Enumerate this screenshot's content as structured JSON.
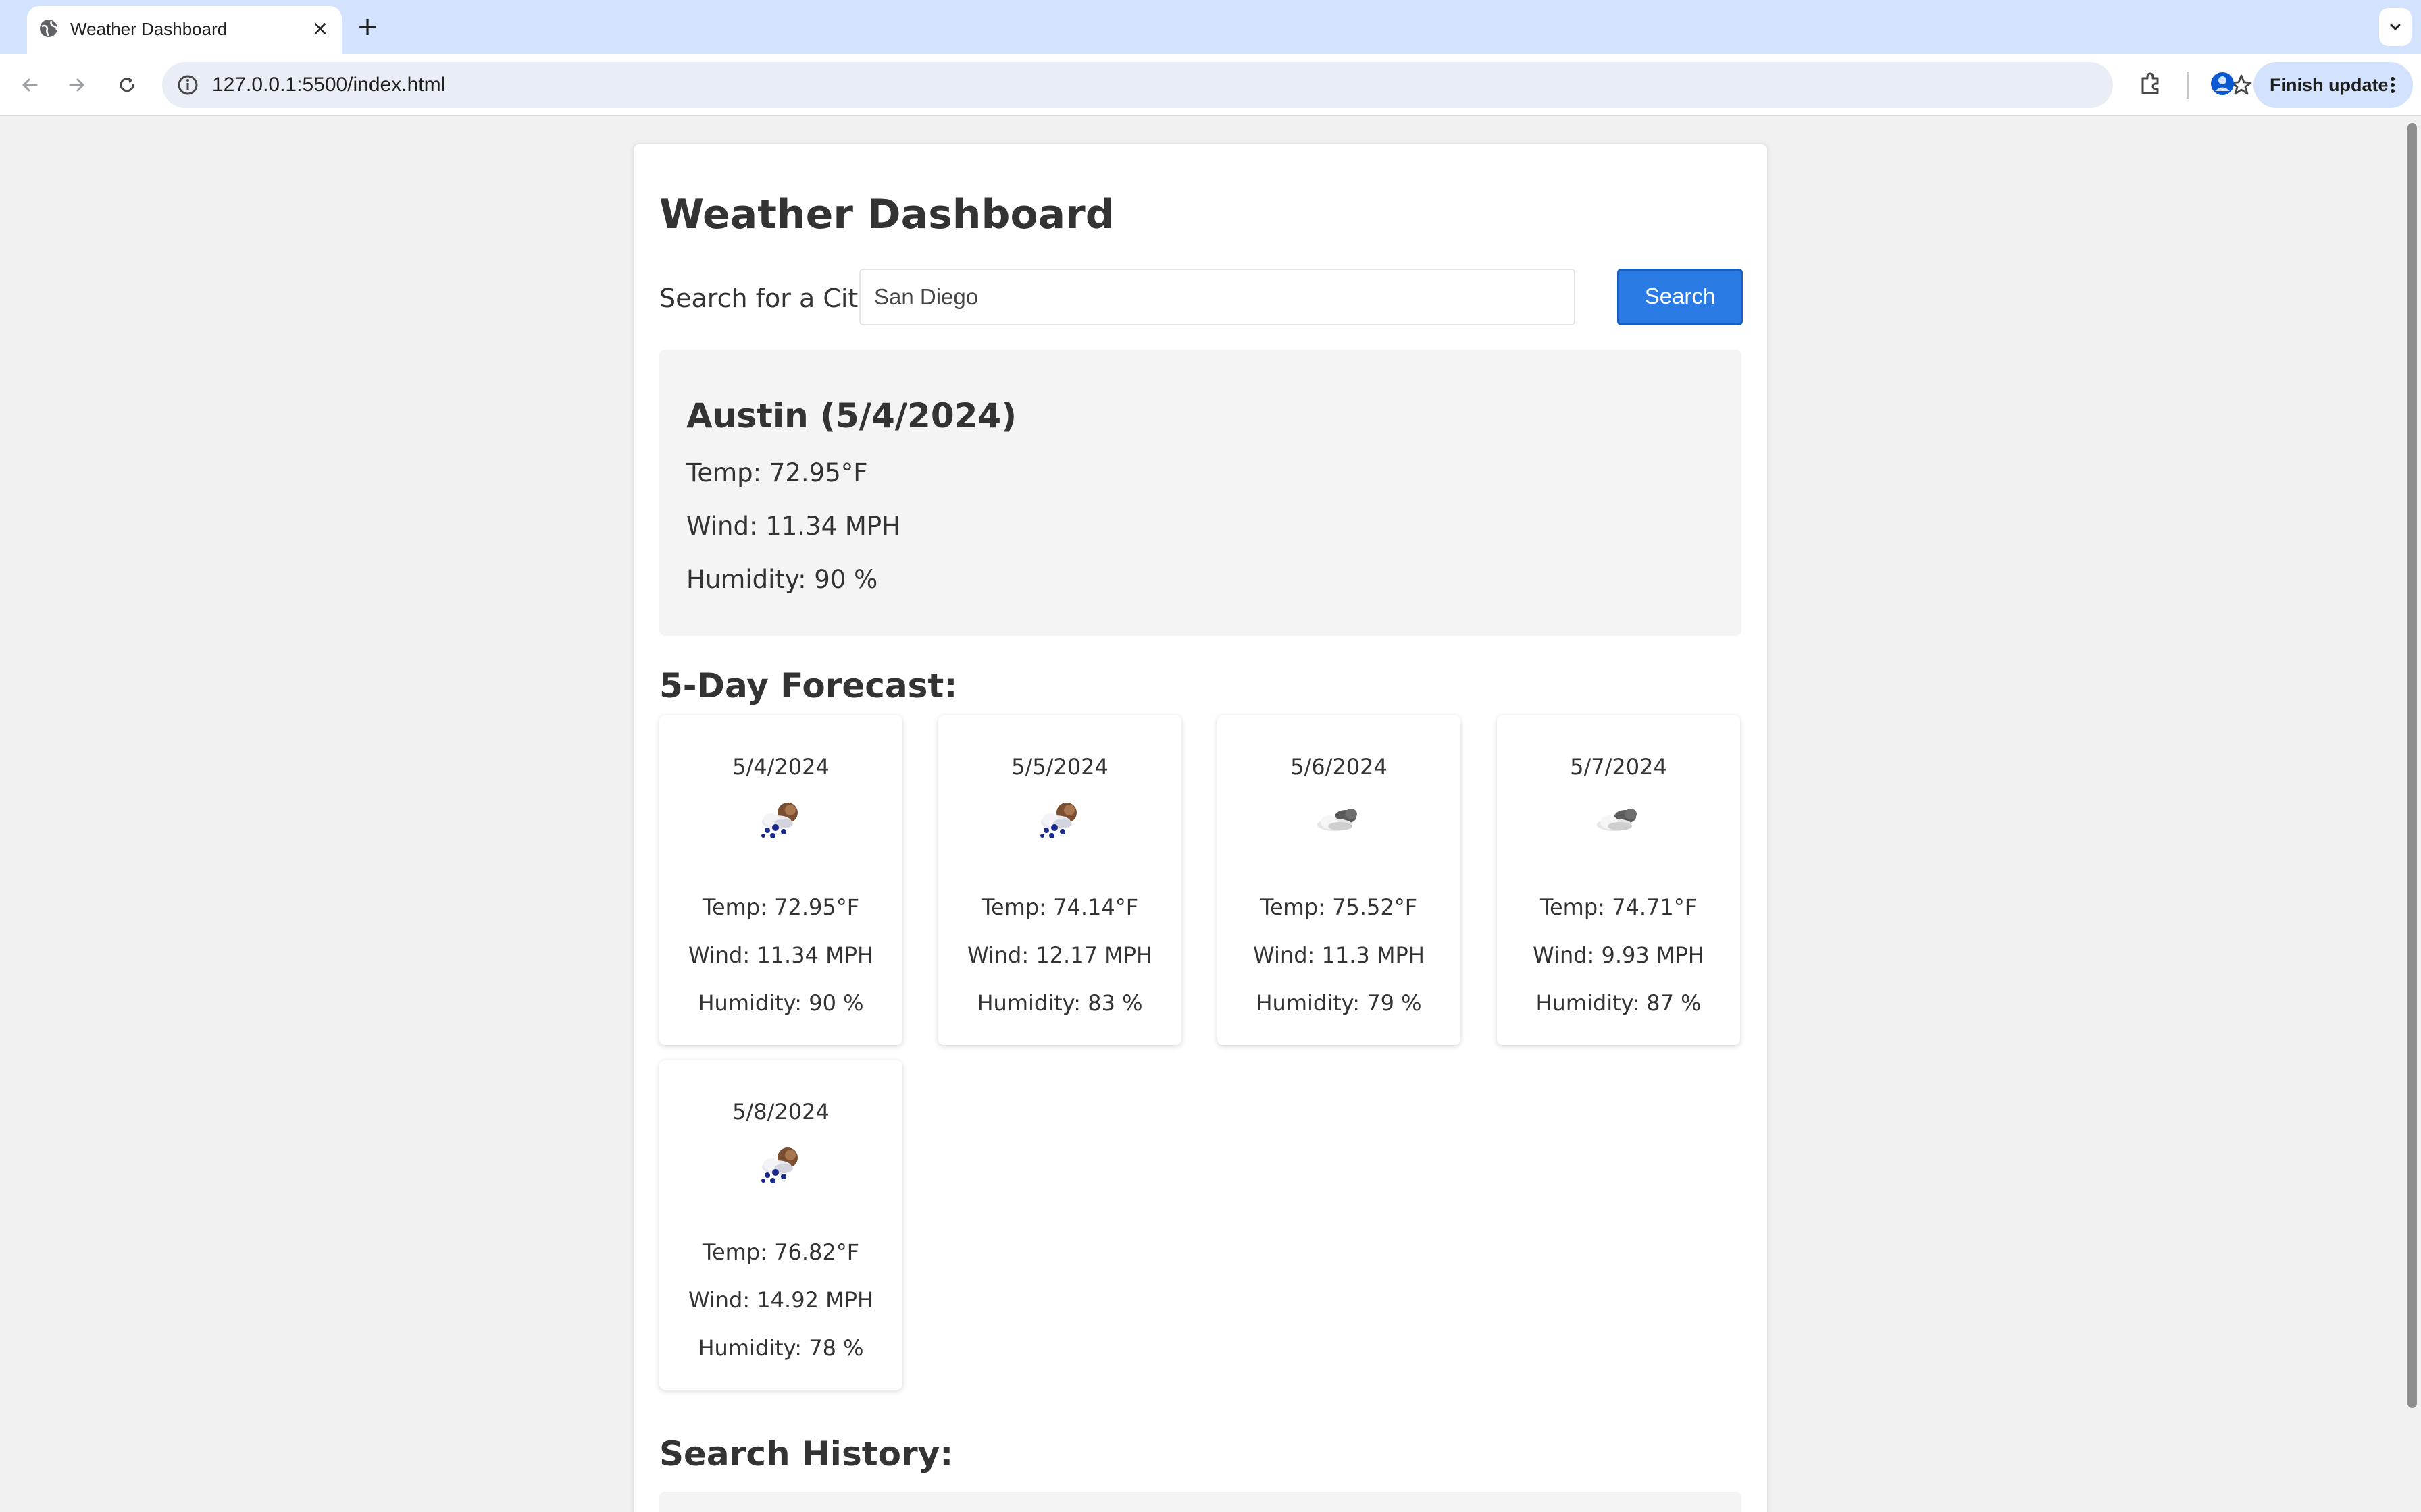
{
  "browser": {
    "tab_title": "Weather Dashboard",
    "url": "127.0.0.1:5500/index.html",
    "finish_update_label": "Finish update"
  },
  "page": {
    "title": "Weather Dashboard",
    "search": {
      "label": "Search for a City:",
      "value": "San Diego",
      "button_label": "Search"
    },
    "current": {
      "heading": "Austin (5/4/2024)",
      "temp": "Temp: 72.95°F",
      "wind": "Wind: 11.34 MPH",
      "humidity": "Humidity: 90 %"
    },
    "forecast_heading": "5-Day Forecast:",
    "forecast": [
      {
        "date": "5/4/2024",
        "icon": "rain-icon",
        "temp": "Temp: 72.95°F",
        "wind": "Wind: 11.34 MPH",
        "humidity": "Humidity: 90 %"
      },
      {
        "date": "5/5/2024",
        "icon": "rain-icon",
        "temp": "Temp: 74.14°F",
        "wind": "Wind: 12.17 MPH",
        "humidity": "Humidity: 83 %"
      },
      {
        "date": "5/6/2024",
        "icon": "clouds-icon",
        "temp": "Temp: 75.52°F",
        "wind": "Wind: 11.3 MPH",
        "humidity": "Humidity: 79 %"
      },
      {
        "date": "5/7/2024",
        "icon": "clouds-icon",
        "temp": "Temp: 74.71°F",
        "wind": "Wind: 9.93 MPH",
        "humidity": "Humidity: 87 %"
      },
      {
        "date": "5/8/2024",
        "icon": "rain-icon",
        "temp": "Temp: 76.82°F",
        "wind": "Wind: 14.92 MPH",
        "humidity": "Humidity: 78 %"
      }
    ],
    "history_heading": "Search History:"
  },
  "colors": {
    "accent": "#2b7be4",
    "tabbar": "#d3e3fd",
    "text": "#333333"
  }
}
